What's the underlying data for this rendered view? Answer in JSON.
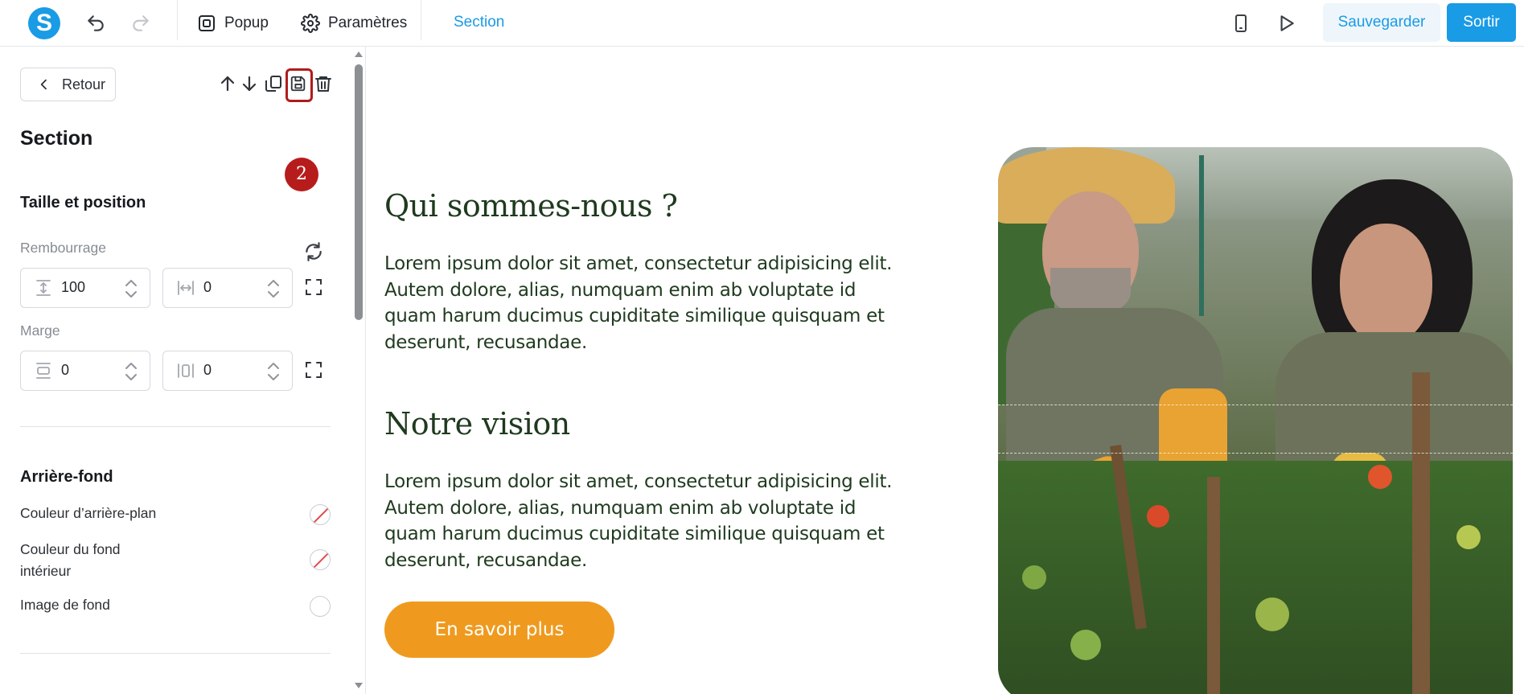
{
  "topbar": {
    "logo_letter": "S",
    "popup_label": "Popup",
    "settings_label": "Paramètres",
    "section_label": "Section",
    "save_label": "Sauvegarder",
    "exit_label": "Sortir",
    "accent_color": "#1a9be6"
  },
  "sidebar": {
    "back_label": "Retour",
    "step_badge": "2",
    "title": "Section",
    "size_position": {
      "heading": "Taille et position",
      "padding_label": "Rembourrage",
      "padding_vertical": "100",
      "padding_horizontal": "0",
      "margin_label": "Marge",
      "margin_vertical": "0",
      "margin_horizontal": "0"
    },
    "background": {
      "heading": "Arrière-fond",
      "bg_color_label": "Couleur d’arrière-plan",
      "inner_color_label_line1": "Couleur du fond",
      "inner_color_label_line2": "intérieur",
      "bg_image_label": "Image de fond"
    }
  },
  "canvas": {
    "heading_1": "Qui sommes-nous ?",
    "paragraph_1": [
      "Lorem ipsum dolor sit amet, consectetur adipisicing elit.",
      "Autem dolore, alias, numquam enim ab voluptate id",
      "quam harum ducimus cupiditate similique quisquam et",
      "deserunt, recusandae."
    ],
    "heading_2": "Notre vision",
    "paragraph_2": [
      "Lorem ipsum dolor sit amet, consectetur adipisicing elit.",
      "Autem dolore, alias, numquam enim ab voluptate id",
      "quam harum ducimus cupiditate similique quisquam et",
      "deserunt, recusandae."
    ],
    "cta_label": "En savoir plus",
    "cta_color": "#ef9a1e",
    "text_color": "#1f3a1e"
  }
}
